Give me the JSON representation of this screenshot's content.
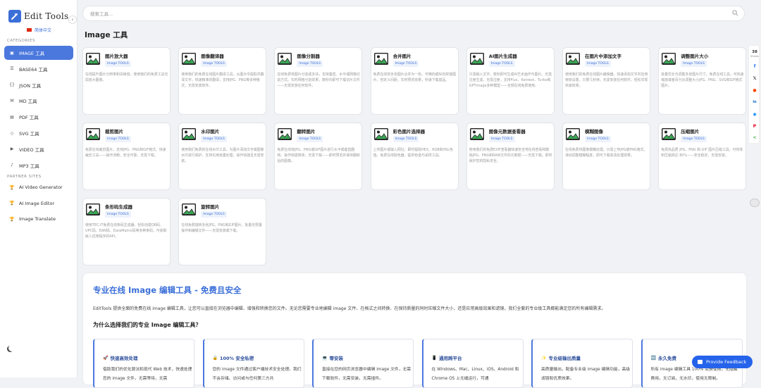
{
  "brand": {
    "title": "Edit Tools",
    "language": "简体中文"
  },
  "sidebar": {
    "categories_label": "CATEGORIES",
    "partner_label": "PARTNER SITES",
    "categories": [
      {
        "label": "IMAGE 工具",
        "icon": "image-icon",
        "active": true
      },
      {
        "label": "BASE64 工具",
        "icon": "base64-icon"
      },
      {
        "label": "JSON 工具",
        "icon": "json-icon"
      },
      {
        "label": "MD 工具",
        "icon": "markdown-icon"
      },
      {
        "label": "PDF 工具",
        "icon": "pdf-icon"
      },
      {
        "label": "SVG 工具",
        "icon": "svg-icon"
      },
      {
        "label": "VIDEO 工具",
        "icon": "video-icon"
      },
      {
        "label": "MP3 工具",
        "icon": "mp3-icon"
      }
    ],
    "partners": [
      {
        "label": "AI Video Generator",
        "icon": "trophy-icon"
      },
      {
        "label": "AI Image Editor",
        "icon": "trophy-icon"
      },
      {
        "label": "Image Translate",
        "icon": "trophy-icon"
      }
    ]
  },
  "search": {
    "placeholder": "搜索工具..."
  },
  "section_title": "Image 工具",
  "badge": "Image TOOLS",
  "tools": [
    {
      "title": "图片放大器",
      "desc": "在线提升图片分辨率和清晰度。使用我们的免费工具无损放大图像。"
    },
    {
      "title": "图像翻译器",
      "desc": "使用我们的免费在线图片翻译工具，从图片中提取并翻译文字。快速精准的翻译；支持JPG、PNG等多种格式，无需安装软件。"
    },
    {
      "title": "图像分割器",
      "desc": "在线免费将图片分割成多块，支持垂直、水平或网格切割方式。实时网格分割效果，数秒内即可下载切片文件——无需安装任何软件。"
    },
    {
      "title": "合并图片",
      "desc": "免费在线将多张图片合并为一张。可横向或纵向拼接图片，自定义间距，实时预览效果，秒速下载成品。"
    },
    {
      "title": "AI图片生成器",
      "desc": "只需输入文字，数秒即可生成AI艺术画作与图片。无需注册生成，无需注册，支持Flux、Kontext、Turbo和GPTimage多种模型——全部在线免费使用。"
    },
    {
      "title": "在图片中添加文字",
      "desc": "使用我们的免费在线图片编辑器，快速添加文字并应用特效设置，只要几秒钟。无需安装任何软件，轻松实现快速效果。"
    },
    {
      "title": "调整图片大小",
      "desc": "批量优化与调整多张图片尺寸。免费在线工具，可快速缩放或者百分比调整大小JPG、PNG、SVG和GIF格式图片。"
    },
    {
      "title": "裁剪图片",
      "desc": "免费在线裁剪图片。支持JPG、PNG和GIF格式。快速裁剪工具——操作流畅，安全可靠，无需下载。"
    },
    {
      "title": "水印图片",
      "desc": "使用我们免费的在线水印工具，为图片添加文字或图像水印进行保护。支持实用批量处理，操作快捷且无需安装。"
    },
    {
      "title": "翻转图片",
      "desc": "免费在线将JPG、PNG或GIF图片进行水平或垂直翻转。操作快捷简单，无需下载——即时预览并保存翻转后的图像。"
    },
    {
      "title": "彩色图片选择器",
      "desc": "上传图片或输入网址，即时提取HEX、RGB和HSL色值。免费在线取色器，提供色值与采样工具。"
    },
    {
      "title": "图像元数据查看器",
      "desc": "使用我们的免费EXIF查看器快速安全地在线查看和删除JPG、PNG和RAW文件的元数据——无需下载，即时保护您的隐私安全。"
    },
    {
      "title": "模糊图像",
      "desc": "在线免费将图像模糊处理。只需上传JPG或PNG格式，滑动调整模糊程度，即可下载高清处理效果。"
    },
    {
      "title": "压缩图片",
      "desc": "免费高品质 JPG、PNG 和 GIF 图片压缩工具。可将体积压缩高达 80%——安全稳定，无需安装。"
    },
    {
      "title": "条形码生成器",
      "desc": "使用TEC-IT免费在线条码生成器，轻松创建QR码、UPC码、EAN码、DataMatrix码等多种条码，可获取嵌入应用程序的API。"
    },
    {
      "title": "旋转图片",
      "desc": "在线免费旋转多张JPG、PNG和GIF图片。批量无限量操作和编辑文件——无需安装或下载。"
    }
  ],
  "article": {
    "title": "专业在线 Image 编辑工具 - 免费且安全",
    "intro": "EditTools 提供全面的免费在线 image 编辑工具，让您可以直接在浏览器中编辑、增强和转换您的文件。无论您需要专业地编辑 image 文件、在格式之间转换、在保持质量的同时压缩文件大小，还是应用高级效果和滤镜，我们全套的专业级工具都能满足您的所有编辑需求。",
    "why_title": "为什么选择我们的专业 Image 编辑工具？",
    "features": [
      {
        "icon": "rocket-icon",
        "emoji": "🚀",
        "title": "快速高效处理",
        "desc": "借助我们的优化算法和现代 Web 技术，快速处理您的 image 文件，无需等待，无需"
      },
      {
        "icon": "lock-icon",
        "emoji": "🔒",
        "title": "100% 安全私密",
        "desc": "您的 image 文件通过客户端技术安全处理。我们不会存储、访问或与任何第三方共"
      },
      {
        "icon": "monitor-icon",
        "emoji": "💻",
        "title": "零安装",
        "desc": "直接在您的网页浏览器中编辑 image 文件，无需下载软件，无需安装，无需插件。"
      },
      {
        "icon": "phone-icon",
        "emoji": "📱",
        "title": "通用跨平台",
        "desc": "在 Windows、Mac、Linux、iOS、Android 和 Chrome OS 上无缝运行，可通"
      },
      {
        "icon": "sparkle-icon",
        "emoji": "✨",
        "title": "专业级输出质量",
        "desc": "高质量输出，配备专业级 image 编辑功能，高级滤镜和优质效果。"
      },
      {
        "icon": "infinity-icon",
        "emoji": "🆓",
        "title": "永久免费",
        "desc": "所有 image 编辑工具 100% 免费使用，无隐藏费用，无订阅，无水印，使用无限制。"
      }
    ]
  },
  "share": {
    "count": "38",
    "label": "Shares"
  },
  "feedback": "Provide Feedback"
}
